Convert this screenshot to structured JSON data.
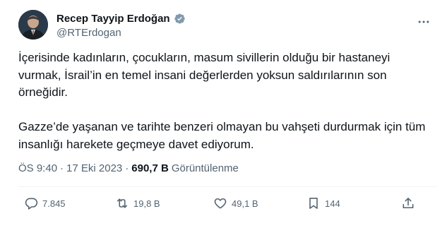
{
  "author": {
    "display_name": "Recep Tayyip Erdoğan",
    "handle": "@RTErdogan",
    "verified": true
  },
  "tweet": {
    "paragraphs": [
      "İçerisinde kadınların, çocukların, masum sivillerin olduğu bir hastaneyi vurmak, İsrail’in en temel insani değerlerden yoksun saldırılarının son örneğidir.",
      "Gazze’de yaşanan ve tarihte benzeri olmayan bu vahşeti durdurmak için tüm insanlığı harekete geçmeye davet ediyorum."
    ]
  },
  "meta": {
    "time": "ÖS 9:40",
    "separator1": "·",
    "date": "17 Eki 2023",
    "separator2": "·",
    "views_count": "690,7 B",
    "views_label": "Görüntülenme"
  },
  "actions": {
    "reply_count": "7.845",
    "retweet_count": "19,8 B",
    "like_count": "49,1 B",
    "bookmark_count": "144"
  },
  "icons": {
    "more": "more-dots-icon",
    "verified": "verified-badge-icon",
    "reply": "reply-icon",
    "retweet": "retweet-icon",
    "like": "heart-icon",
    "bookmark": "bookmark-icon",
    "share": "share-icon"
  },
  "colors": {
    "verified": "#829aab",
    "text_primary": "#0f1419",
    "text_secondary": "#536471",
    "divider": "#eff3f4"
  }
}
